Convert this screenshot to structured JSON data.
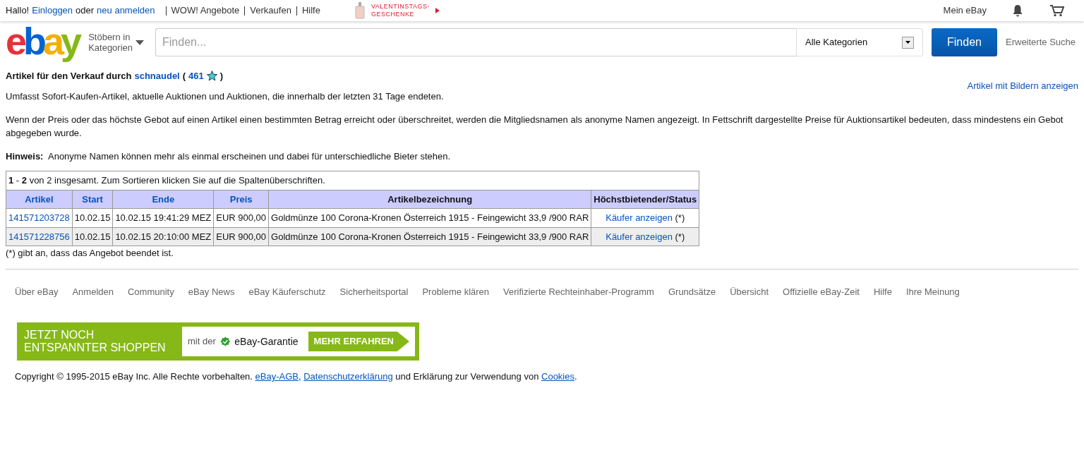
{
  "top_bar": {
    "greeting": "Hallo!",
    "login_link": "Einloggen",
    "or_text": "oder",
    "register_link": "neu anmelden",
    "links": [
      "WOW! Angebote",
      "Verkaufen",
      "Hilfe"
    ],
    "promo_lines": [
      "VALENTINSTAGS-",
      "GESCHENKE"
    ],
    "my_ebay": "Mein eBay"
  },
  "header": {
    "logo": [
      {
        "letter": "e",
        "color": "#e53238"
      },
      {
        "letter": "b",
        "color": "#0064d2"
      },
      {
        "letter": "a",
        "color": "#f5af02"
      },
      {
        "letter": "y",
        "color": "#86b817"
      }
    ],
    "browse_lines": [
      "Stöbern in",
      "Kategorien"
    ],
    "search": {
      "placeholder": "Finden..."
    },
    "category": "Alle Kategorien",
    "search_button": "Finden",
    "advanced": "Erweiterte Suche"
  },
  "title": {
    "prefix": "Artikel für den Verkauf durch",
    "seller": "schnaudel",
    "open": "(",
    "score": "461",
    "close": ")"
  },
  "pictures_link": "Artikel mit Bildern anzeigen",
  "paragraphs": [
    "Umfasst Sofort-Kaufen-Artikel, aktuelle Auktionen und Auktionen, die innerhalb der letzten 31 Tage endeten.",
    "Wenn der Preis oder das höchste Gebot auf einen Artikel einen bestimmten Betrag erreicht oder überschreitet, werden die Mitgliedsnamen als anonyme Namen angezeigt. In Fettschrift dargestellte Preise für Auktionsartikel bedeuten, dass mindestens ein Gebot abgegeben wurde.",
    "**Hinweis:**  Anonyme Namen können mehr als einmal erscheinen und dabei für unterschiedliche Bieter stehen."
  ],
  "table": {
    "caption": "**1** - **2** von 2 insgesamt. Zum Sortieren klicken Sie auf die Spaltenüberschriften.",
    "columns": [
      {
        "label": "Artikel",
        "sortable": true
      },
      {
        "label": "Start",
        "sortable": true
      },
      {
        "label": "Ende",
        "sortable": true
      },
      {
        "label": "Preis",
        "sortable": true
      },
      {
        "label": "Artikelbezeichnung",
        "sortable": false
      },
      {
        "label": "Höchstbietender/Status",
        "sortable": false
      }
    ],
    "rows": [
      {
        "item": "141571203728",
        "start": "10.02.15",
        "end": "10.02.15 19:41:29 MEZ",
        "price": "EUR 900,00",
        "title": "Goldmünze 100 Corona-Kronen Österreich 1915 - Feingewicht 33,9 /900 RAR",
        "buyer_link": "Käufer anzeigen",
        "status": "(*)"
      },
      {
        "item": "141571228756",
        "start": "10.02.15",
        "end": "10.02.15 20:10:00 MEZ",
        "price": "EUR 900,00",
        "title": "Goldmünze 100 Corona-Kronen Österreich 1915 - Feingewicht 33,9 /900 RAR",
        "buyer_link": "Käufer anzeigen",
        "status": "(*)"
      }
    ],
    "footnote": "(*) gibt an, dass das Angebot beendet ist."
  },
  "footer_links": [
    "Über eBay",
    "Anmelden",
    "Community",
    "eBay News",
    "eBay Käuferschutz",
    "Sicherheitsportal",
    "Probleme klären",
    "Verifizierte Rechteinhaber-Programm",
    "Grundsätze",
    "Übersicht",
    "Offizielle eBay-Zeit",
    "Hilfe",
    "Ihre Meinung"
  ],
  "banner": {
    "headline_lines": [
      "JETZT NOCH",
      "ENTSPANNTER SHOPPEN"
    ],
    "with_text": "mit der",
    "guarantee": "eBay-Garantie",
    "button": "MEHR ERFAHREN"
  },
  "copyright": [
    {
      "kind": "text",
      "text": "Copyright © 1995-2015 eBay Inc. Alle Rechte vorbehalten. "
    },
    {
      "kind": "link",
      "text": "eBay-AGB"
    },
    {
      "kind": "text",
      "text": ", "
    },
    {
      "kind": "link",
      "text": "Datenschutzerklärung"
    },
    {
      "kind": "text",
      "text": " und Erklärung zur Verwendung von "
    },
    {
      "kind": "link",
      "text": "Cookies"
    },
    {
      "kind": "text",
      "text": "."
    }
  ]
}
